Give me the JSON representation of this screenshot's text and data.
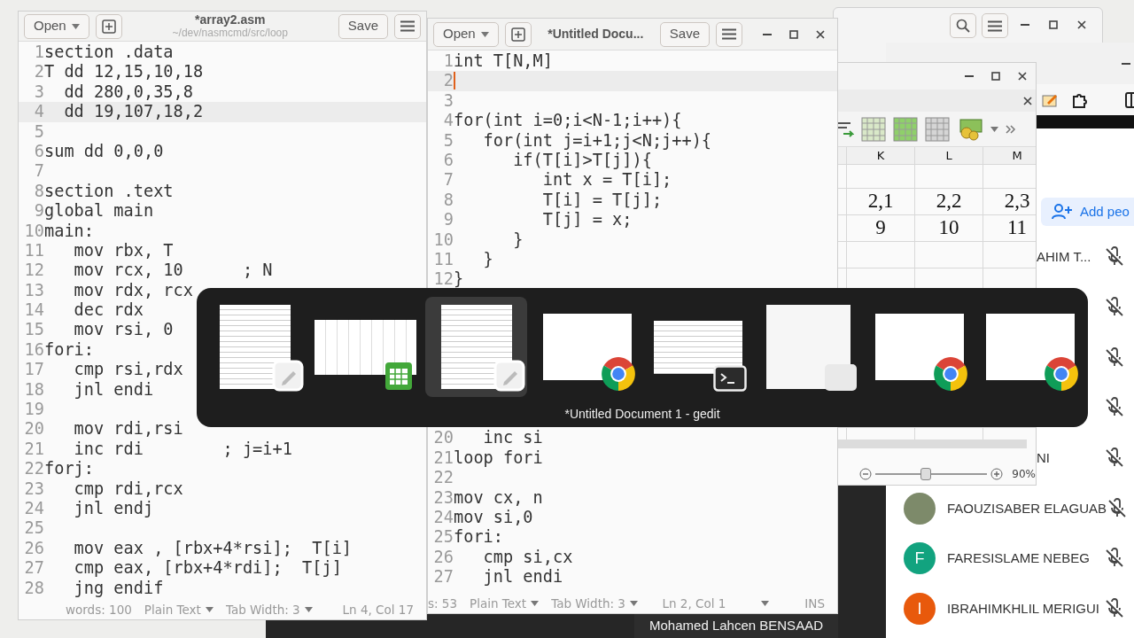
{
  "left_editor": {
    "open_label": "Open",
    "title": "*array2.asm",
    "subtitle": "~/dev/nasmcmd/src/loop",
    "save_label": "Save",
    "focused": false,
    "lines": [
      {
        "n": "1",
        "text": "section .data",
        "current": false
      },
      {
        "n": "2",
        "text": "T dd 12,15,10,18",
        "current": false
      },
      {
        "n": "3",
        "text": "  dd 280,0,35,8",
        "current": false
      },
      {
        "n": "4",
        "text": "  dd 19,107,18,2",
        "current": true
      },
      {
        "n": "5",
        "current": false
      },
      {
        "n": "6",
        "text": "sum dd 0,0,0",
        "current": false
      },
      {
        "n": "7",
        "current": false
      },
      {
        "n": "8",
        "text": "section .text",
        "current": false
      },
      {
        "n": "9",
        "text": "global main",
        "current": false
      },
      {
        "n": "10",
        "text": "main:",
        "current": false
      },
      {
        "n": "11",
        "text": "   mov rbx, T",
        "current": false
      },
      {
        "n": "12",
        "text": "   mov rcx, 10      ; N",
        "current": false
      },
      {
        "n": "13",
        "text": "   mov rdx, rcx",
        "current": false
      },
      {
        "n": "14",
        "text": "   dec rdx",
        "current": false
      },
      {
        "n": "15",
        "text": "   mov rsi, 0",
        "current": false
      },
      {
        "n": "16",
        "text": "fori:",
        "current": false
      },
      {
        "n": "17",
        "text": "   cmp rsi,rdx",
        "current": false
      },
      {
        "n": "18",
        "text": "   jnl endi",
        "current": false
      },
      {
        "n": "19",
        "current": false
      },
      {
        "n": "20",
        "text": "   mov rdi,rsi",
        "current": false
      },
      {
        "n": "21",
        "text": "   inc rdi        ; j=i+1",
        "current": false
      },
      {
        "n": "22",
        "text": "forj:",
        "current": false
      },
      {
        "n": "23",
        "text": "   cmp rdi,rcx",
        "current": false
      },
      {
        "n": "24",
        "text": "   jnl endj",
        "current": false
      },
      {
        "n": "25",
        "current": false
      },
      {
        "n": "26",
        "text": "   mov eax , [rbx+4*rsi];  T[i]",
        "current": false
      },
      {
        "n": "27",
        "text": "   cmp eax, [rbx+4*rdi];  T[j]",
        "current": false
      },
      {
        "n": "28",
        "text": "   jng endif",
        "current": false
      }
    ],
    "status": [
      {
        "text": "words: 100",
        "dropdown": false
      },
      {
        "text": "Plain Text",
        "dropdown": true
      },
      {
        "text": "Tab Width: 3",
        "dropdown": true
      },
      {
        "text": "Ln 4, Col 17",
        "dropdown": false
      }
    ]
  },
  "middle_editor": {
    "open_label": "Open",
    "title": "*Untitled Docu...",
    "save_label": "Save",
    "focused": true,
    "lines": [
      {
        "n": "1",
        "text": "int T[N,M]",
        "current": false
      },
      {
        "n": "2",
        "current": true
      },
      {
        "n": "3",
        "current": false
      },
      {
        "n": "4",
        "text": "for(int i=0;i<N-1;i++){",
        "current": false
      },
      {
        "n": "5",
        "text": "   for(int j=i+1;j<N;j++){",
        "current": false
      },
      {
        "n": "6",
        "text": "      if(T[i]>T[j]){",
        "current": false
      },
      {
        "n": "7",
        "text": "         int x = T[i];",
        "current": false
      },
      {
        "n": "8",
        "text": "         T[i] = T[j];",
        "current": false
      },
      {
        "n": "9",
        "text": "         T[j] = x;",
        "current": false
      },
      {
        "n": "10",
        "text": "      }",
        "current": false
      },
      {
        "n": "11",
        "text": "   }",
        "current": false
      },
      {
        "n": "12",
        "text": "}",
        "current": false
      },
      {
        "n": "20",
        "text": "   inc si",
        "current": false
      },
      {
        "n": "21",
        "text": "loop fori",
        "current": false
      },
      {
        "n": "22",
        "current": false
      },
      {
        "n": "23",
        "text": "mov cx, n",
        "current": false
      },
      {
        "n": "24",
        "text": "mov si,0",
        "current": false
      },
      {
        "n": "25",
        "text": "fori:",
        "current": false
      },
      {
        "n": "26",
        "text": "   cmp si,cx",
        "current": false
      },
      {
        "n": "27",
        "text": "   jnl endi",
        "current": false
      }
    ],
    "status": [
      {
        "text": "s: 53",
        "dropdown": false
      },
      {
        "text": "Plain Text",
        "dropdown": true
      },
      {
        "text": "Tab Width: 3",
        "dropdown": true
      },
      {
        "text": "Ln 2, Col 1",
        "dropdown": false
      },
      {
        "dropdown": true
      },
      {
        "text": "INS",
        "dropdown": false
      }
    ]
  },
  "spreadsheet": {
    "columns": [
      "K",
      "L",
      "M"
    ],
    "rows": [
      [
        "2,1",
        "2,2",
        "2,3"
      ],
      [
        "9",
        "10",
        "11"
      ]
    ],
    "zoom": {
      "level": 0.45,
      "reading": "90%"
    }
  },
  "meet_panel": {
    "add_button": "Add peo",
    "participants": [
      {
        "kind": "clipped",
        "name": "AHIM T...",
        "muted": true
      },
      {
        "kind": "covered",
        "muted": true
      },
      {
        "kind": "covered",
        "muted": true
      },
      {
        "kind": "covered",
        "muted": true
      },
      {
        "kind": "clipped",
        "name": "NI",
        "muted": true
      },
      {
        "kind": "photo",
        "name": "FAOUZISABER ELAGUAB",
        "muted": true
      },
      {
        "kind": "initial",
        "name": "FARESISLAME NEBEG",
        "initial": "F",
        "color": "#12a37f",
        "muted": true
      },
      {
        "kind": "initial",
        "name": "IBRAHIMKHLIL MERIGUI",
        "initial": "I",
        "color": "#e8590c",
        "muted": true
      }
    ]
  },
  "switcher": {
    "items": [
      {
        "kind": "gedit",
        "selected": false
      },
      {
        "kind": "calc",
        "selected": false
      },
      {
        "kind": "gedit",
        "selected": true
      },
      {
        "kind": "chrome",
        "selected": false
      },
      {
        "kind": "terminal",
        "selected": false
      },
      {
        "kind": "calculator",
        "selected": false
      },
      {
        "kind": "chrome",
        "selected": false
      },
      {
        "kind": "chrome",
        "selected": false
      }
    ],
    "caption": "*Untitled Document 1 - gedit"
  },
  "video_label": "Mohamed Lahcen BENSAAD"
}
